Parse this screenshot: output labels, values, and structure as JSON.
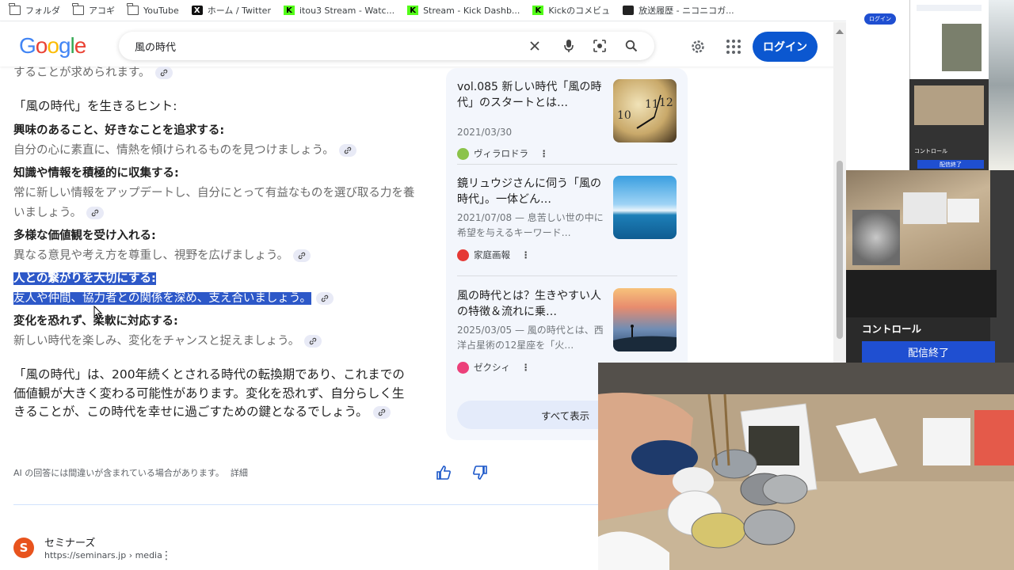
{
  "bookmarks": [
    {
      "label": "フォルダ",
      "icon": "folder-icon"
    },
    {
      "label": "アコギ",
      "icon": "folder-icon"
    },
    {
      "label": "YouTube",
      "icon": "folder-icon"
    },
    {
      "label": "ホーム / Twitter",
      "icon": "x-icon"
    },
    {
      "label": "itou3 Stream - Watc...",
      "icon": "kick-icon"
    },
    {
      "label": "Stream - Kick Dashb...",
      "icon": "kick-icon"
    },
    {
      "label": "Kickのコメビュ",
      "icon": "kick-icon"
    },
    {
      "label": "放送履歴 - ニコニコガ...",
      "icon": "tv-icon"
    }
  ],
  "header": {
    "logo": "Google",
    "search_value": "風の時代",
    "login_label": "ログイン"
  },
  "ai": {
    "top_cut_text": "することが求められます。",
    "hints_heading": "「風の時代」を生きるヒント:",
    "hints": [
      {
        "title": "興味のあること、好きなことを追求する:",
        "body": "自分の心に素直に、情熱を傾けられるものを見つけましょう。",
        "highlight": false
      },
      {
        "title": "知識や情報を積極的に収集する:",
        "body": "常に新しい情報をアップデートし、自分にとって有益なものを選び取る力を養いましょう。",
        "highlight": false
      },
      {
        "title": "多様な価値観を受け入れる:",
        "body": "異なる意見や考え方を尊重し、視野を広げましょう。",
        "highlight": false
      },
      {
        "title": "人との繋がりを大切にする:",
        "body": "友人や仲間、協力者との関係を深め、支え合いましょう。",
        "highlight": true
      },
      {
        "title": "変化を恐れず、柔軟に対応する:",
        "body": "新しい時代を楽しみ、変化をチャンスと捉えましょう。",
        "highlight": false
      }
    ],
    "conclusion": "「風の時代」は、200年続くとされる時代の転換期であり、これまでの価値観が大きく変わる可能性があります。変化を恐れず、自分らしく生きることが、この時代を幸せに過ごすための鍵となるでしょう。",
    "disclaimer": "AI の回答には間違いが含まれている場合があります。",
    "detail_link": "詳細"
  },
  "sources": {
    "cards": [
      {
        "title": "vol.085 新しい時代「風の時代」のスタートとは…",
        "date": "2021/03/30",
        "site": "ヴィラロドラ",
        "fav_color": "#8bc34a"
      },
      {
        "title": "鏡リュウジさんに伺う「風の時代」。一体どん…",
        "date": "2021/07/08 — 息苦しい世の中に希望を与えるキーワード…",
        "site": "家庭画報",
        "fav_color": "#e53935"
      },
      {
        "title": "風の時代とは？生きやすい人の特徴＆流れに乗…",
        "date": "2025/03/05 — 風の時代とは、西洋占星術の12星座を「火…",
        "site": "ゼクシィ",
        "fav_color": "#ec407a"
      }
    ],
    "show_all": "すべて表示"
  },
  "result": {
    "favicon_letter": "S",
    "name": "セミナーズ",
    "url": "https://seminars.jp › media"
  },
  "obs": {
    "control_label": "コントロール",
    "end_stream": "配信終了",
    "mini_login": "ログイン",
    "mini_control": "コントロール",
    "mini_end": "配信終了"
  }
}
